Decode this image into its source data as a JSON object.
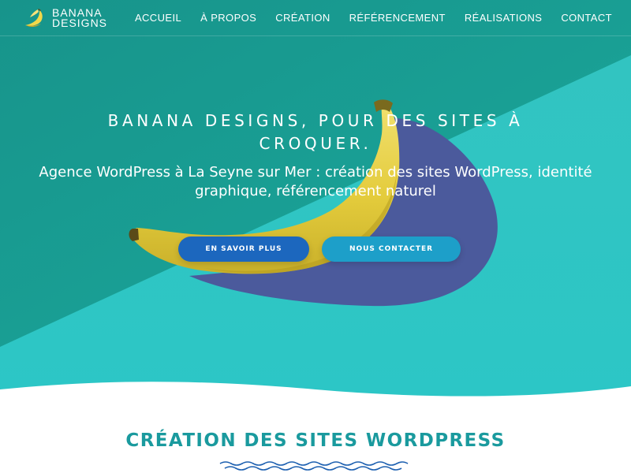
{
  "brand": {
    "line1": "BANANA",
    "line2": "DESIGNS",
    "logo_icon": "banana-logo-icon"
  },
  "nav": {
    "items": [
      {
        "label": "ACCUEIL"
      },
      {
        "label": "À PROPOS"
      },
      {
        "label": "CRÉATION"
      },
      {
        "label": "RÉFÉRENCEMENT"
      },
      {
        "label": "RÉALISATIONS"
      },
      {
        "label": "CONTACT"
      }
    ]
  },
  "hero": {
    "title": "BANANA DESIGNS, POUR DES SITES À CROQUER.",
    "subtitle": "Agence WordPress à La Seyne sur Mer : création des sites WordPress, identité graphique, référencement naturel",
    "btn_more": "EN SAVOIR PLUS",
    "btn_contact": "NOUS CONTACTER",
    "image_icon": "banana-image"
  },
  "section": {
    "title": "CRÉATION DES SITES WORDPRESS"
  },
  "colors": {
    "hero_bg": "#2fc3c0",
    "hero_diagonal": "#1a9f95",
    "shadow_blob": "#4a5b9a",
    "btn_more": "#1c67be",
    "btn_contact": "#1d9fc9",
    "section_title": "#1a9a9e",
    "banana_yellow": "#ecd74a"
  }
}
